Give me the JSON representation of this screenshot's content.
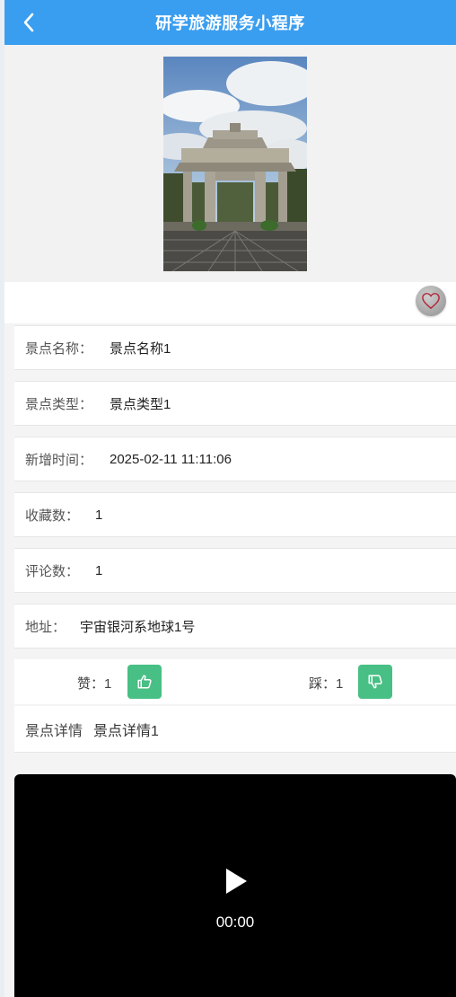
{
  "nav": {
    "title": "研学旅游服务小程序"
  },
  "info": {
    "name_label": "景点名称：",
    "name_value": "景点名称1",
    "type_label": "景点类型：",
    "type_value": "景点类型1",
    "time_label": "新增时间：",
    "time_value": "2025-02-11 11:11:06",
    "fav_label": "收藏数：",
    "fav_value": "1",
    "comment_label": "评论数：",
    "comment_value": "1",
    "addr_label": "地址：",
    "addr_value": "宇宙银河系地球1号"
  },
  "votes": {
    "like_label": "赞：",
    "like_value": "1",
    "dislike_label": "踩：",
    "dislike_value": "1"
  },
  "detail": {
    "label": "景点详情",
    "value": "景点详情1"
  },
  "video": {
    "time": "00:00"
  },
  "colors": {
    "nav": "#3a9ef0",
    "vote_button": "#48bf84"
  },
  "icons": [
    "back-arrow-icon",
    "heart-icon",
    "thumbs-up-icon",
    "thumbs-down-icon",
    "play-icon"
  ]
}
